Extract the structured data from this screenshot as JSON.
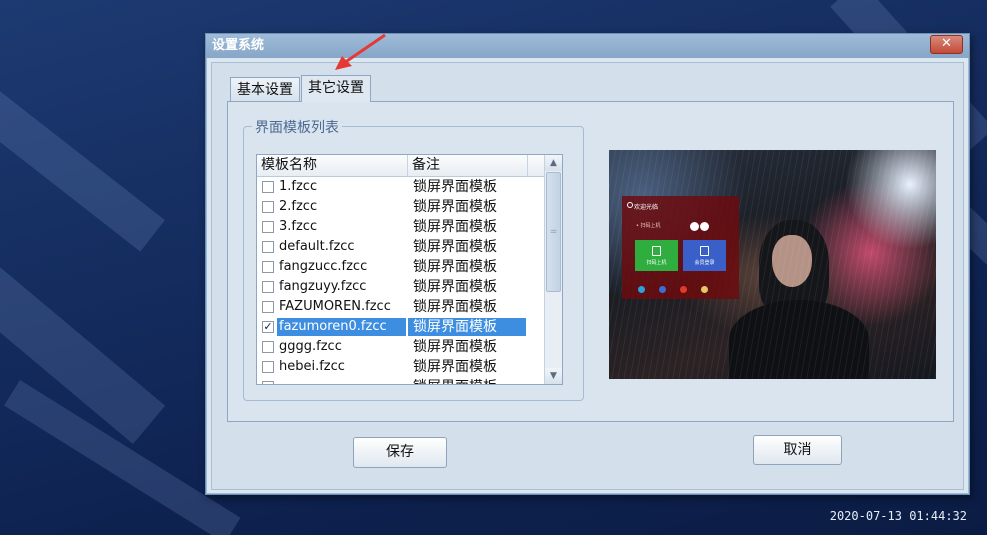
{
  "dialog": {
    "title": "设置系统",
    "close_glyph": "✕",
    "tabs": [
      {
        "label": "基本设置",
        "active": false
      },
      {
        "label": "其它设置",
        "active": true
      }
    ],
    "group_title": "界面模板列表",
    "list": {
      "columns": [
        "模板名称",
        "备注"
      ],
      "rows": [
        {
          "name": "1.fzcc",
          "note": "锁屏界面模板",
          "checked": false
        },
        {
          "name": "2.fzcc",
          "note": "锁屏界面模板",
          "checked": false
        },
        {
          "name": "3.fzcc",
          "note": "锁屏界面模板",
          "checked": false
        },
        {
          "name": "default.fzcc",
          "note": "锁屏界面模板",
          "checked": false
        },
        {
          "name": "fangzucc.fzcc",
          "note": "锁屏界面模板",
          "checked": false
        },
        {
          "name": "fangzuyy.fzcc",
          "note": "锁屏界面模板",
          "checked": false
        },
        {
          "name": "FAZUMOREN.fzcc",
          "note": "锁屏界面模板",
          "checked": false
        },
        {
          "name": "fazumoren0.fzcc",
          "note": "锁屏界面模板",
          "checked": true,
          "selected": true
        },
        {
          "name": "gggg.fzcc",
          "note": "锁屏界面模板",
          "checked": false
        },
        {
          "name": "hebei.fzcc",
          "note": "锁屏界面模板",
          "checked": false
        },
        {
          "name": "",
          "note": "锁屏界面模板",
          "checked": false
        }
      ]
    },
    "preview": {
      "card_title": "欢迎光临",
      "card_subtitle": "• 扫码上机",
      "tile_green": "扫码上机",
      "tile_blue": "会员登录"
    },
    "buttons": {
      "save": "保存",
      "cancel": "取消"
    }
  },
  "taskbar": {
    "clock": "2020-07-13 01:44:32"
  },
  "colors": {
    "selection": "#3d8de0",
    "annotation_arrow": "#e53935"
  }
}
